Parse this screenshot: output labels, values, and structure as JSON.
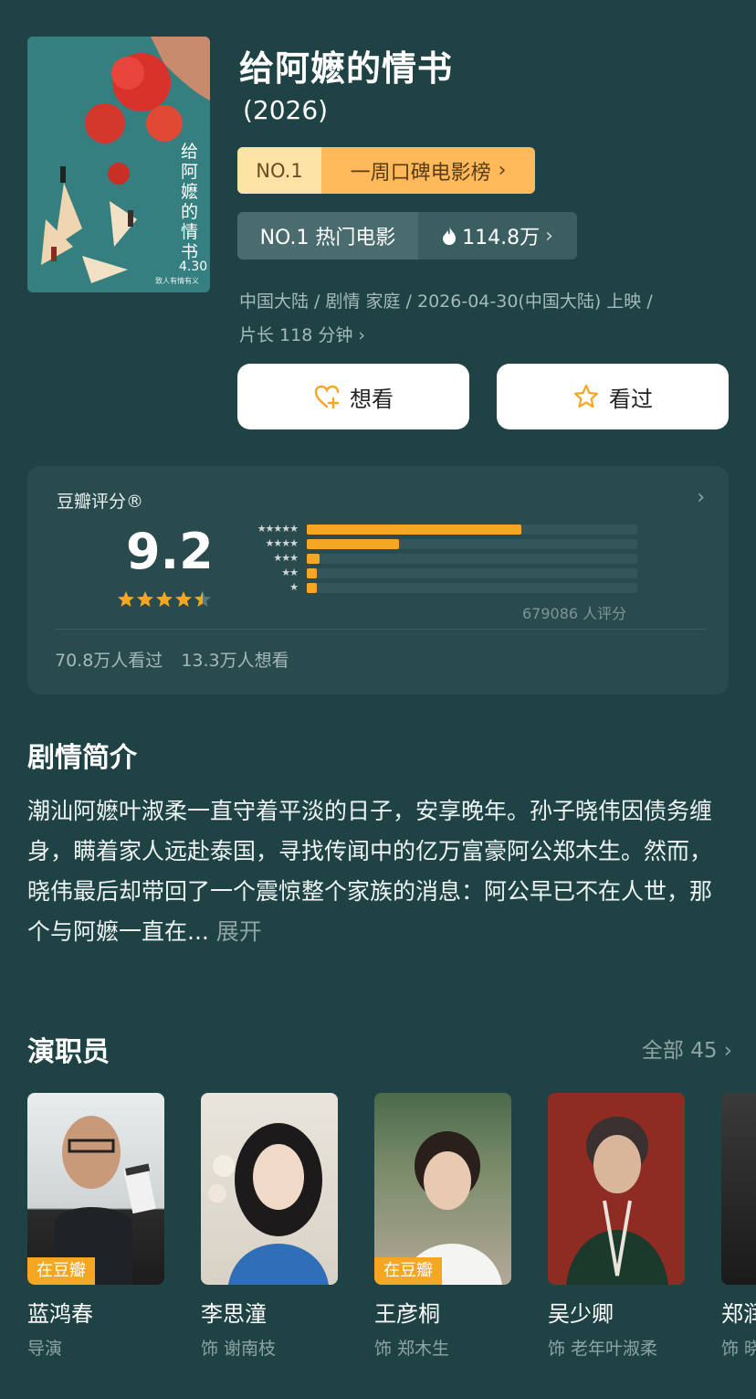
{
  "movie": {
    "title": "给阿嬷的情书",
    "year": "(2026)",
    "poster": {
      "vertical_title": "给阿嬷的情书",
      "date": "4.30",
      "tagline": "致人有情有义"
    },
    "rank_badge": {
      "left": "NO.1",
      "right": "一周口碑电影榜"
    },
    "hot_badge": {
      "left": "NO.1 热门电影",
      "right": "114.8万"
    },
    "meta_line1": "中国大陆 / 剧情 家庭 / 2026-04-30(中国大陆) 上映 /",
    "meta_line2": "片长 118 分钟"
  },
  "actions": {
    "want_label": "想看",
    "seen_label": "看过"
  },
  "rating": {
    "label": "豆瓣评分®",
    "score": "9.2",
    "stars_value": 4.5,
    "distribution": [
      {
        "stars": "★★★★★",
        "fraction": 0.65
      },
      {
        "stars": "★★★★",
        "fraction": 0.28
      },
      {
        "stars": "★★★",
        "fraction": 0.04
      },
      {
        "stars": "★★",
        "fraction": 0.03
      },
      {
        "stars": "★",
        "fraction": 0.03
      }
    ],
    "count": "679086 人评分",
    "watched": "70.8万人看过",
    "wants": "13.3万人想看"
  },
  "synopsis": {
    "title": "剧情简介",
    "text": "潮汕阿嬷叶淑柔一直守着平淡的日子，安享晚年。孙子晓伟因债务缠身，瞒着家人远赴泰国，寻找传闻中的亿万富豪阿公郑木生。然而，晓伟最后却带回了一个震惊整个家族的消息：阿公早已不在人世，那个与阿嬷一直在...",
    "expand": "展开"
  },
  "cast": {
    "title": "演职员",
    "all_label": "全部 45",
    "members": [
      {
        "name": "蓝鸿春",
        "role": "导演",
        "badge": "在豆瓣"
      },
      {
        "name": "李思潼",
        "role": "饰 谢南枝",
        "badge": ""
      },
      {
        "name": "王彦桐",
        "role": "饰 郑木生",
        "badge": "在豆瓣"
      },
      {
        "name": "吴少卿",
        "role": "饰 老年叶淑柔",
        "badge": ""
      },
      {
        "name": "郑润",
        "role": "饰 晓",
        "badge": ""
      }
    ]
  },
  "colors": {
    "background": "#1f4345",
    "accent_orange": "#f5a623",
    "card": "#2a4b4d"
  }
}
